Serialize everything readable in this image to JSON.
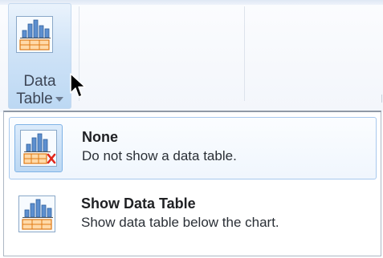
{
  "ribbon": {
    "data_table_button": {
      "label_line1": "Data",
      "label_line2": "Table",
      "icon": "data-table-icon",
      "arrow_icon": "dropdown-arrow-icon"
    }
  },
  "menu": {
    "items": [
      {
        "title": "None",
        "description": "Do not show a data table.",
        "icon": "no-data-table-icon"
      },
      {
        "title": "Show Data Table",
        "description": "Show data table below the chart.",
        "icon": "show-data-table-icon"
      }
    ]
  },
  "colors": {
    "hover_fill": "#cfe3f7",
    "hover_border": "#a8c9ee",
    "chart_blue": "#3f7fc7",
    "table_orange": "#f08a24",
    "remove_red": "#e0261c"
  }
}
